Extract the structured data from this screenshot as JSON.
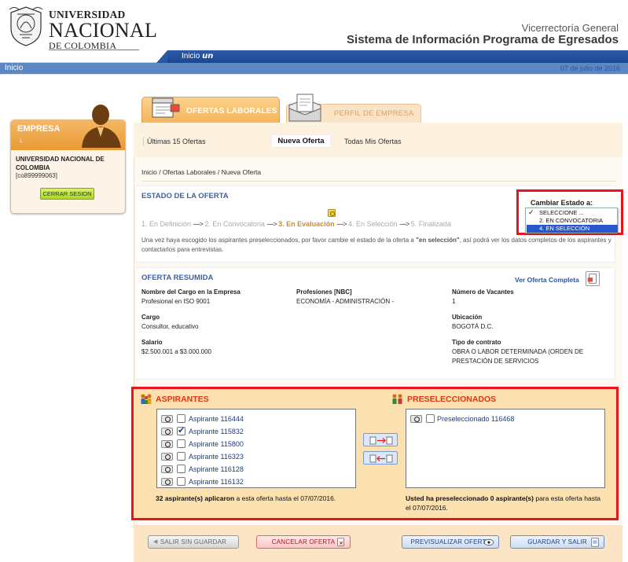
{
  "header": {
    "logo_line1": "UNIVERSIDAD",
    "logo_line2": "NACIONAL",
    "logo_line3": "DE COLOMBIA",
    "vicerrectoria": "Vicerrectoría General",
    "system_title": "Sistema de Información Programa de Egresados"
  },
  "nav": {
    "inicio_un_prefix": "Inicio",
    "inicio_un_suffix": "un",
    "inicio": "Inicio",
    "date": "07 de julio de 2016"
  },
  "empresa": {
    "title": "EMPRESA",
    "arrow": "↓",
    "name": "UNIVERSIDAD NACIONAL DE COLOMBIA",
    "code": "[co899999063]",
    "logout_label": "CERRAR SESION"
  },
  "tabs": {
    "ofertas": "OFERTAS LABORALES",
    "perfil": "PERFIL DE EMPRESA"
  },
  "subnav": {
    "ultimas": "Últimas 15 Ofertas",
    "nueva": "Nueva Oferta",
    "todas": "Todas Mis Ofertas"
  },
  "breadcrumb": "Inicio / Ofertas Laborales / Nueva Oferta",
  "estado": {
    "title": "ESTADO DE LA OFERTA",
    "steps": [
      "1. En Definición",
      "2. En Convocatoria",
      "3. En Evaluación",
      "4. En Selección",
      "5. Finalizada"
    ],
    "arrow": "---->",
    "current_step": 3,
    "description_pre": "Una vez haya escogido los aspirantes preseleccionados, por favor cambie el estado de la oferta a ",
    "description_bold": "\"en selección\"",
    "description_post": ", así podrá ver los datos completos de los aspirantes y contactarlos para entrevistas.",
    "cambiar_label": "Cambiar Estado a:",
    "dropdown_options": [
      "SELECCIONE ...",
      "2. EN CONVOCATORIA",
      "4. EN SELECCIÓN"
    ],
    "dropdown_checkmark": "✓"
  },
  "resumida": {
    "title": "OFERTA RESUMIDA",
    "ver_link": "Ver Oferta Completa",
    "fields": {
      "cargo_empresa_label": "Nombre del Cargo en la Empresa",
      "cargo_empresa_value": "Profesional en ISO 9001",
      "profesiones_label": "Profesiones [NBC]",
      "profesiones_value": "ECONOMÍA - ADMINISTRACIÓN -",
      "vacantes_label": "Número de Vacantes",
      "vacantes_value": "1",
      "cargo_label": "Cargo",
      "cargo_value": "Consultor, educativo",
      "ubicacion_label": "Ubicación",
      "ubicacion_value": "BOGOTÁ D.C.",
      "salario_label": "Salario",
      "salario_value": "$2.500.001 a $3.000.000",
      "contrato_label": "Tipo de contrato",
      "contrato_value_1": "OBRA O LABOR DETERMINADA (ORDEN DE",
      "contrato_value_2": "PRESTACIÓN DE SERVICIOS"
    }
  },
  "aspirantes": {
    "title": "ASPIRANTES",
    "items": [
      {
        "label": "Aspirante 116444",
        "checked": false
      },
      {
        "label": "Aspirante 115832",
        "checked": true
      },
      {
        "label": "Aspirante 115800",
        "checked": false
      },
      {
        "label": "Aspirante 116323",
        "checked": false
      },
      {
        "label": "Aspirante 116128",
        "checked": false
      },
      {
        "label": "Aspirante 116132",
        "checked": false
      }
    ],
    "count_bold": "32 aspirante(s) aplicaron",
    "count_rest": " a esta oferta hasta el 07/07/2016."
  },
  "preseleccionados": {
    "title": "PRESELECCIONADOS",
    "items": [
      {
        "label": "Preseleccionado 116468",
        "checked": false
      }
    ],
    "count_bold": "Usted ha preseleccionado 0 aspirante(s)",
    "count_rest": " para esta oferta hasta el 07/07/2016."
  },
  "buttons": {
    "salir": "SALIR SIN GUARDAR",
    "cancelar": "CANCELAR OFERTA",
    "previsualizar": "PREVISUALIZAR OFERTA",
    "guardar": "GUARDAR Y SALIR"
  },
  "colors": {
    "accent_blue": "#2c5aa8",
    "orange": "#f4b864",
    "highlight_red": "#e8161b"
  }
}
